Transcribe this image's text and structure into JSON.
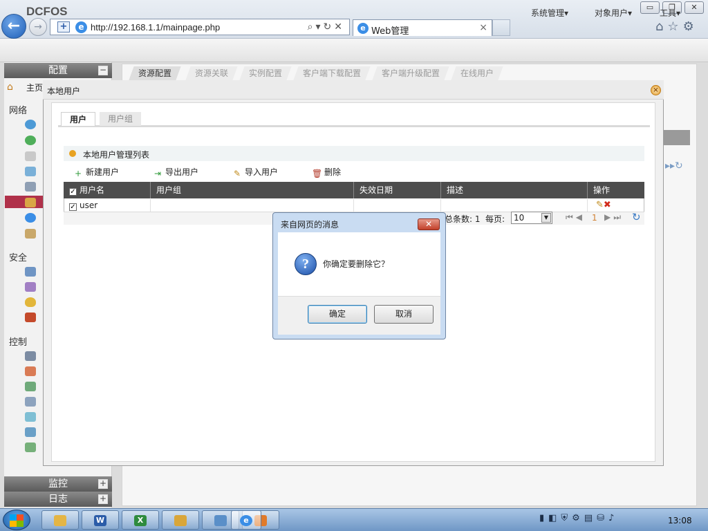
{
  "browser": {
    "url": "http://192.168.1.1/mainpage.php",
    "tab_title": "Web管理",
    "tab_close": "×",
    "win_minimize": "▭",
    "win_restore": "❐",
    "win_close": "✕"
  },
  "app": {
    "logo": "DCFOS",
    "menus": [
      "系统管理▾",
      "对象用户▾",
      "工具▾"
    ]
  },
  "sidebar": {
    "config_title": "配置",
    "home_label": "主页",
    "sections": [
      "网络",
      "安全",
      "控制"
    ],
    "monitor_title": "监控",
    "log_title": "日志",
    "collapse_symbol": "−",
    "expand_symbol": "+"
  },
  "content_tabs": [
    "资源配置",
    "资源关联",
    "实例配置",
    "客户端下载配置",
    "客户端升级配置",
    "在线用户"
  ],
  "modal": {
    "title": "本地用户",
    "close": "×",
    "subtabs": [
      "用户",
      "用户组"
    ],
    "list_title": "本地用户管理列表",
    "toolbar": {
      "new_user": "新建用户",
      "export_user": "导出用户",
      "import_user": "导入用户",
      "delete": "删除"
    },
    "columns": [
      "用户名",
      "用户组",
      "失效日期",
      "描述",
      "操作"
    ],
    "rows": [
      {
        "username": "user",
        "group": "",
        "expire": "",
        "desc": "",
        "checked": "✓"
      }
    ],
    "pager": {
      "total_label": "总条数: 1",
      "per_page_label": "每页:",
      "per_page_value": "10",
      "page": "1"
    }
  },
  "dialog": {
    "title": "来自网页的消息",
    "message": "你确定要删除它？",
    "ok": "确定",
    "cancel": "取消",
    "close": "✕",
    "icon_glyph": "?"
  },
  "taskbar": {
    "clock": "13:08",
    "apps": [
      "explorer",
      "word",
      "excel",
      "paint",
      "remote-desktop",
      "media",
      "internet-explorer"
    ]
  },
  "colors": {
    "accent_selected": "#b0314a",
    "grid_header": "#4d4d4d",
    "dialog_frame": "#c9dcf2"
  }
}
